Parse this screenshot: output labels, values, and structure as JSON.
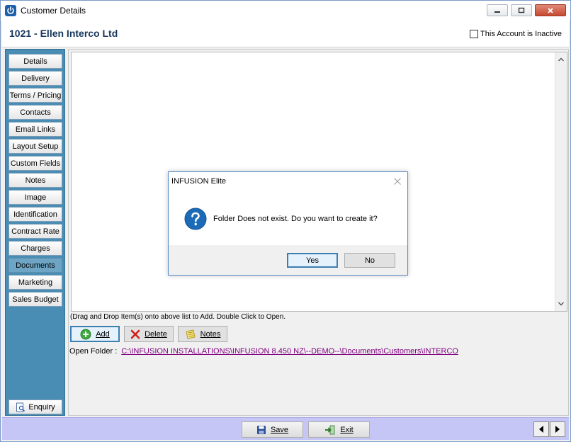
{
  "window": {
    "title": "Customer Details",
    "icon": "power-icon"
  },
  "header": {
    "account_title": "1021 - Ellen Interco Ltd",
    "inactive_label": "This Account is Inactive",
    "inactive_checked": false
  },
  "sidebar": {
    "items": [
      {
        "label": "Details"
      },
      {
        "label": "Delivery"
      },
      {
        "label": "Terms / Pricing"
      },
      {
        "label": "Contacts"
      },
      {
        "label": "Email Links"
      },
      {
        "label": "Layout Setup"
      },
      {
        "label": "Custom Fields"
      },
      {
        "label": "Notes"
      },
      {
        "label": "Image"
      },
      {
        "label": "Identification"
      },
      {
        "label": "Contract Rate"
      },
      {
        "label": "Charges"
      },
      {
        "label": "Documents",
        "active": true
      },
      {
        "label": "Marketing"
      },
      {
        "label": "Sales Budget"
      }
    ],
    "enquiry_label": "Enquiry"
  },
  "documents": {
    "hint": "(Drag and Drop Item(s) onto above list to Add. Double Click to Open.",
    "add_label": "Add",
    "delete_label": "Delete",
    "notes_label": "Notes",
    "open_folder_label": "Open Folder :",
    "folder_path": "C:\\INFUSION INSTALLATIONS\\INFUSION 8.450 NZ\\--DEMO--\\Documents\\Customers\\INTERCO"
  },
  "footer": {
    "save_label": "Save",
    "exit_label": "Exit"
  },
  "dialog": {
    "title": "INFUSION Elite",
    "message": "Folder Does not exist. Do you want to create it?",
    "yes_label": "Yes",
    "no_label": "No",
    "icon": "question-icon"
  },
  "colors": {
    "sidebar_bg": "#4a8db4",
    "bottom_bar_bg": "#c6c6f6",
    "title_color": "#17365d",
    "link_color": "#800080",
    "question_icon": "#1c6bb8"
  }
}
